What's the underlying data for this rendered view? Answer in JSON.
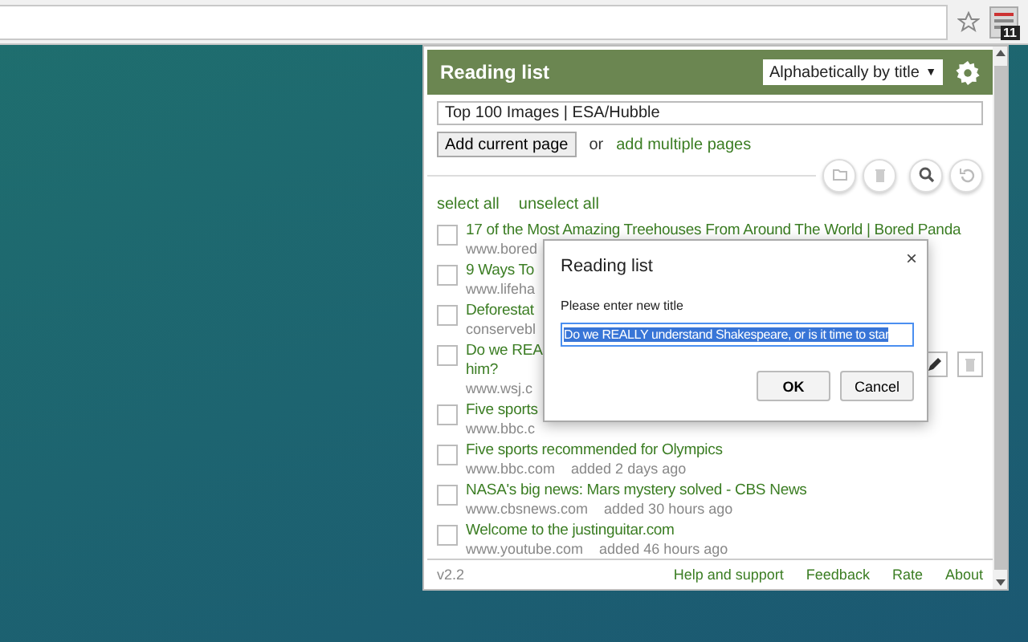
{
  "toolbar": {
    "extension_badge": "11"
  },
  "popup": {
    "title": "Reading list",
    "sort": "Alphabetically by title",
    "sort_arrow": "▼",
    "url_value": "Top 100 Images | ESA/Hubble",
    "add_button": "Add current page",
    "or_text": "or",
    "add_multiple": "add multiple pages",
    "select_all": "select all",
    "unselect_all": "unselect all",
    "items": [
      {
        "title_lines": [
          "17 of the Most Amazing Treehouses From Around The World | Bored Panda"
        ],
        "url": "www.bored",
        "checked": false,
        "actions_visible": false
      },
      {
        "title_lines": [
          "9 Ways To"
        ],
        "url": "www.lifeha",
        "checked": false,
        "actions_visible": false
      },
      {
        "title_lines": [
          "Deforestat"
        ],
        "url": "conservebl",
        "checked": false,
        "actions_visible": false
      },
      {
        "title_lines": [
          "Do we REA",
          "him?"
        ],
        "url": "www.wsj.c",
        "checked": false,
        "actions_visible": true
      },
      {
        "title_lines": [
          "Five sports"
        ],
        "url": "www.bbc.c",
        "checked": false,
        "actions_visible": false
      },
      {
        "title_lines": [
          "Five sports recommended for Olympics"
        ],
        "url": "www.bbc.com",
        "added": "added 2 days ago",
        "checked": false,
        "actions_visible": false
      },
      {
        "title_lines": [
          "NASA's big news: Mars mystery solved - CBS News"
        ],
        "url": "www.cbsnews.com",
        "added": "added 30 hours ago",
        "checked": false,
        "actions_visible": false
      },
      {
        "title_lines": [
          "Welcome to the justinguitar.com"
        ],
        "url": "www.youtube.com",
        "added": "added 46 hours ago",
        "checked": false,
        "actions_visible": false
      }
    ],
    "version": "v2.2",
    "footer_links": [
      "Help and support",
      "Feedback",
      "Rate",
      "About"
    ]
  },
  "dialog": {
    "title": "Reading list",
    "close": "×",
    "label": "Please enter new title",
    "value": "Do we REALLY understand Shakespeare, or is it time to star",
    "buttons": [
      "OK",
      "Cancel"
    ]
  }
}
